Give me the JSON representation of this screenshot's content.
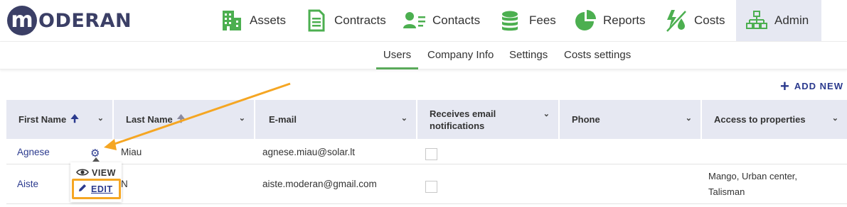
{
  "brand": {
    "logo_letter": "m",
    "logo_rest": "ODERAN"
  },
  "nav": {
    "items": [
      {
        "label": "Assets",
        "icon": "building-icon"
      },
      {
        "label": "Contracts",
        "icon": "document-icon"
      },
      {
        "label": "Contacts",
        "icon": "contact-card-icon"
      },
      {
        "label": "Fees",
        "icon": "coins-icon"
      },
      {
        "label": "Reports",
        "icon": "pie-chart-icon"
      },
      {
        "label": "Costs",
        "icon": "energy-costs-icon"
      },
      {
        "label": "Admin",
        "icon": "hierarchy-icon",
        "active": true
      }
    ]
  },
  "subnav": {
    "tabs": [
      {
        "label": "Users",
        "active": true
      },
      {
        "label": "Company Info"
      },
      {
        "label": "Settings"
      },
      {
        "label": "Costs settings"
      }
    ]
  },
  "toolbar": {
    "add_new_label": "ADD NEW"
  },
  "table": {
    "columns": [
      {
        "label": "First Name"
      },
      {
        "label": "Last Name"
      },
      {
        "label": "E-mail"
      },
      {
        "label_line1": "Receives email",
        "label_line2": "notifications"
      },
      {
        "label": "Phone"
      },
      {
        "label": "Access to properties"
      }
    ],
    "rows": [
      {
        "first_name": "Agnese",
        "last_name": "Miau",
        "email": "agnese.miau@solar.lt",
        "notifications": false,
        "phone": "",
        "access": []
      },
      {
        "first_name": "Aiste",
        "last_name": "N",
        "email": "aiste.moderan@gmail.com",
        "notifications": false,
        "phone": "",
        "access": [
          "Mango, Urban center,",
          "Talisman"
        ]
      }
    ]
  },
  "row_actions": {
    "view_label": "VIEW",
    "edit_label": "EDIT"
  },
  "colors": {
    "brand": "#3b3f66",
    "nav_icon": "#4caf50",
    "link": "#2b3a8e",
    "header_bg": "#e6e8f2",
    "active_tab_underline": "#5aaa5a",
    "callout": "#f5a623"
  }
}
